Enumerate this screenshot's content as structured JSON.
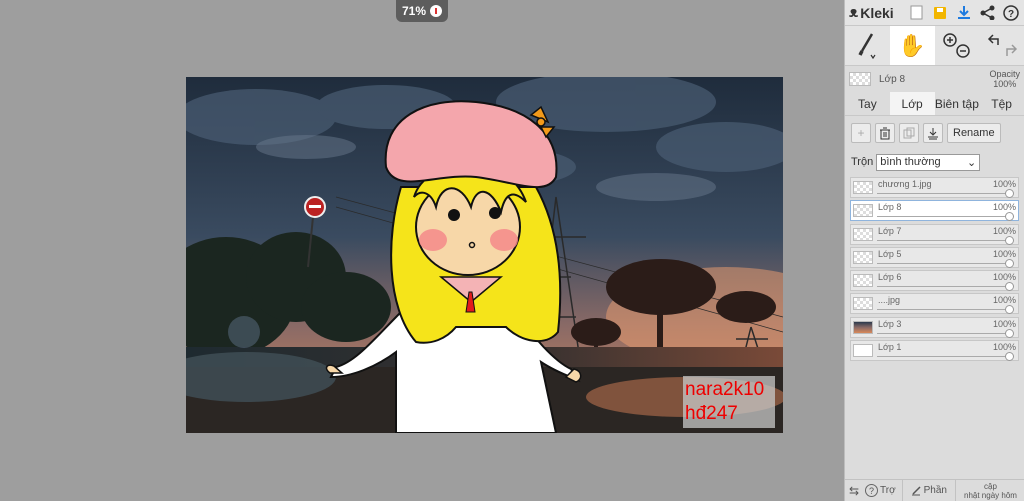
{
  "canvas": {
    "zoom_label": "71%",
    "watermark": {
      "line1": "nara2k10",
      "line2": "hđ247"
    }
  },
  "app": {
    "name": "Kleki"
  },
  "icons": {
    "logo": "kleki-logo-icon",
    "new": "new-file-icon",
    "save": "save-icon",
    "download": "download-icon",
    "share": "share-icon",
    "help": "help-icon",
    "brush": "brush-icon",
    "hand": "hand-icon",
    "zoom_in": "zoom-in-icon",
    "zoom_out": "zoom-out-icon",
    "undo": "undo-icon",
    "redo": "redo-icon"
  },
  "layer_preview": {
    "name": "Lớp 8",
    "opacity_label": "Opacity",
    "opacity_value": "100%"
  },
  "tabs": [
    "Tay",
    "Lớp",
    "Biên tập",
    "Tệp"
  ],
  "layer_toolbar": {
    "rename": "Rename"
  },
  "blend": {
    "label": "Trộn",
    "value": "bình thường"
  },
  "layers": [
    {
      "name": "chương 1.jpg",
      "opacity": "100%"
    },
    {
      "name": "Lớp 8",
      "opacity": "100%"
    },
    {
      "name": "Lớp 7",
      "opacity": "100%"
    },
    {
      "name": "Lớp 5",
      "opacity": "100%"
    },
    {
      "name": "Lớp 6",
      "opacity": "100%"
    },
    {
      "name": "....jpg",
      "opacity": "100%"
    },
    {
      "name": "Lớp 3",
      "opacity": "100%"
    },
    {
      "name": "Lớp 1",
      "opacity": "100%"
    }
  ],
  "bottom": {
    "help": "Trợ",
    "share": "Phần",
    "update_line1": "cập",
    "update_line2": "nhật ngày hôm"
  },
  "colors": {
    "accent_blue": "#1e7be0",
    "save_yellow": "#f2b600",
    "sky_dark": "#2b3a4d",
    "sunset": "#d47a4a"
  }
}
